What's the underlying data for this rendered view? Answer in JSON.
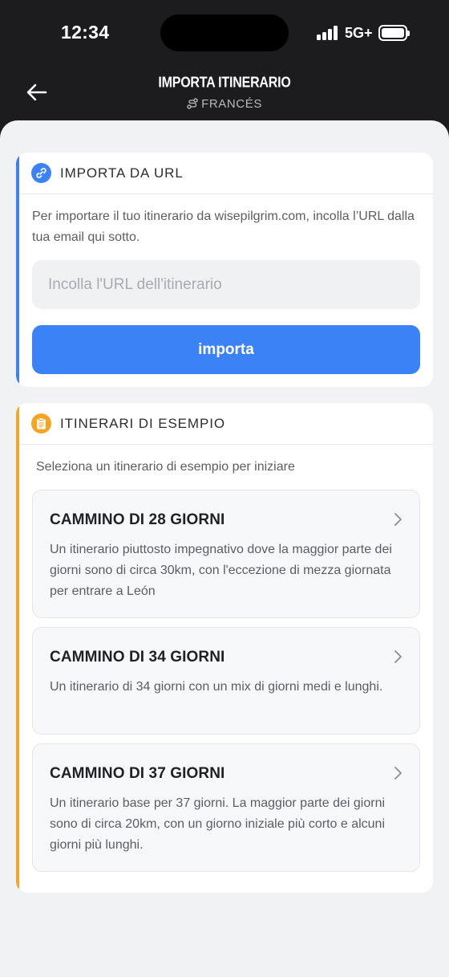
{
  "status": {
    "time": "12:34",
    "network": "5G+"
  },
  "nav": {
    "title": "IMPORTA ITINERARIO",
    "subtitle": "FRANCÉS"
  },
  "import_url": {
    "title": "IMPORTA DA URL",
    "description": "Per importare il tuo itinerario da wisepilgrim.com, incolla l’URL dalla tua email qui sotto.",
    "input_placeholder": "Incolla l'URL dell'itinerario",
    "input_value": "",
    "button_label": "importa",
    "accent_color": "#3b82f6"
  },
  "examples": {
    "title": "ITINERARI DI ESEMPIO",
    "description": "Seleziona un itinerario di esempio per iniziare",
    "accent_color": "#f5a524",
    "items": [
      {
        "title": "CAMMINO DI 28 GIORNI",
        "description": "Un itinerario piuttosto impegnativo dove la maggior parte dei giorni sono di circa 30km, con l'eccezione di mezza giornata per entrare a León"
      },
      {
        "title": "CAMMINO DI 34 GIORNI",
        "description": "Un itinerario di 34 giorni con un mix di giorni medi e lunghi."
      },
      {
        "title": "CAMMINO DI 37 GIORNI",
        "description": "Un itinerario base per 37 giorni. La maggior parte dei giorni sono di circa 20km, con un giorno iniziale più corto e alcuni giorni più lunghi."
      }
    ]
  },
  "icons": {
    "back": "arrow-left-icon",
    "route": "route-icon",
    "link": "link-icon",
    "clipboard": "clipboard-icon",
    "chevron": "chevron-right-icon"
  }
}
